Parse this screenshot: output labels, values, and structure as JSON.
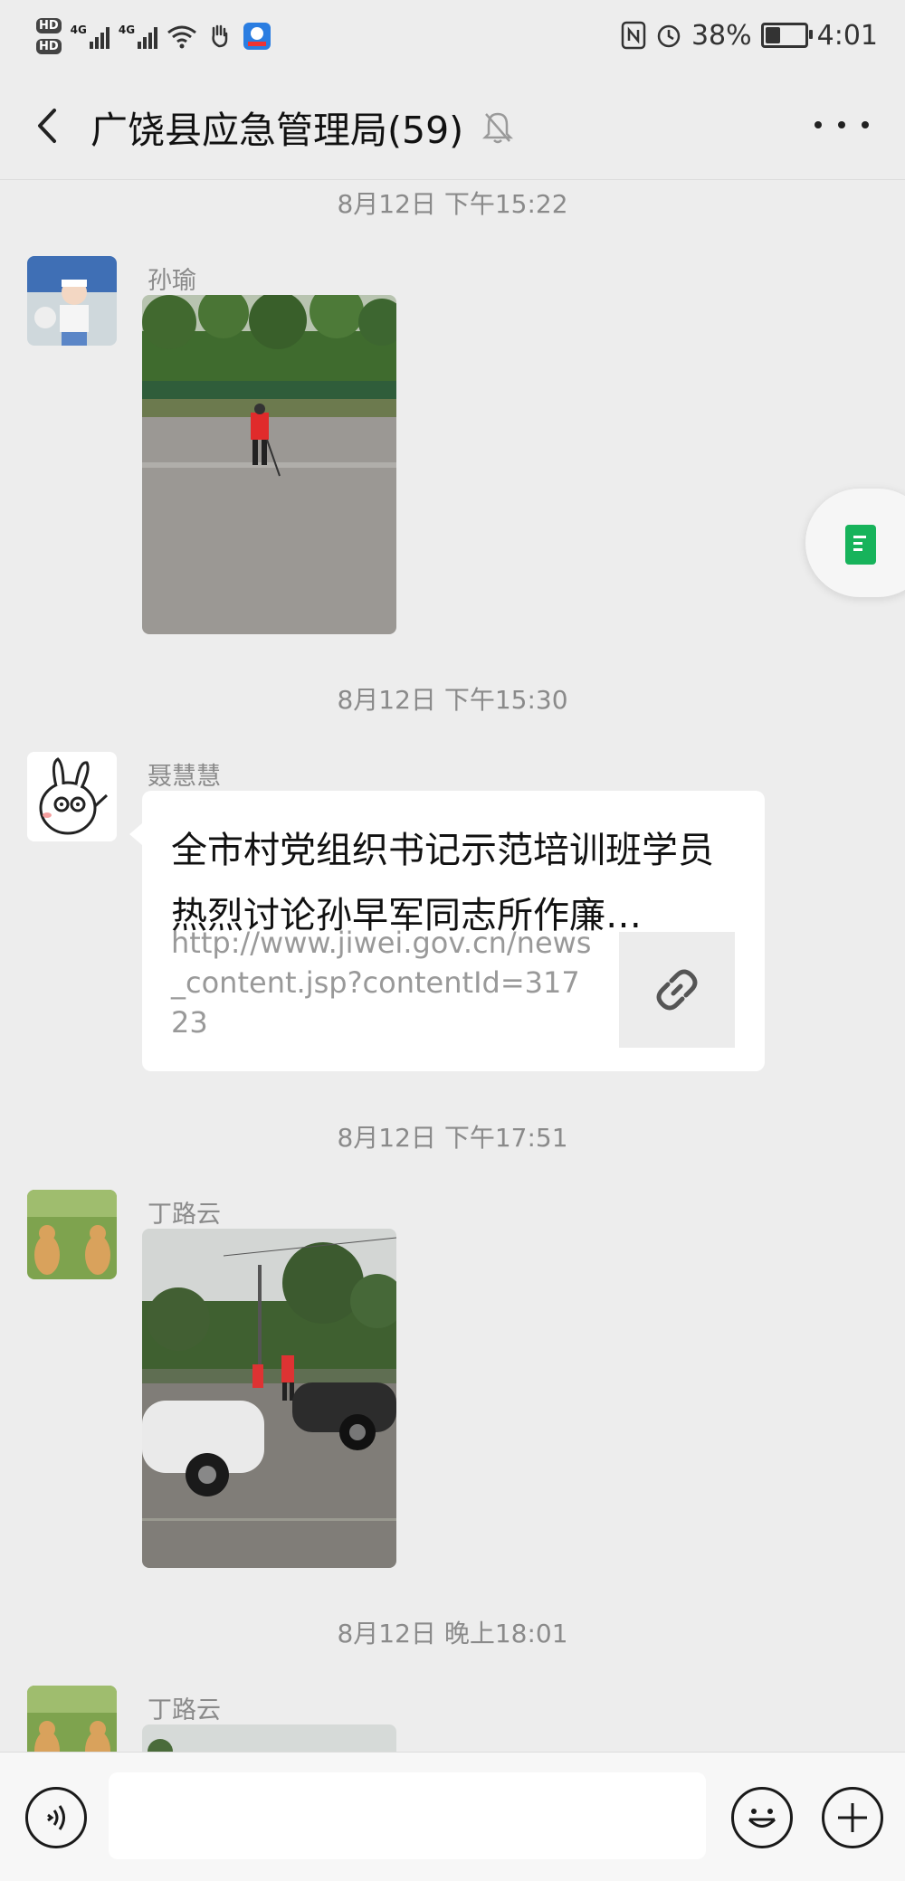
{
  "status_bar": {
    "hd1": "HD",
    "hd2": "HD",
    "net1": "4G",
    "net2": "4G",
    "battery": "38%",
    "time": "4:01"
  },
  "header": {
    "title": "广饶县应急管理局(59)",
    "icons": {
      "back": "chevron-left",
      "mute": "bell-off",
      "more": "ellipsis"
    }
  },
  "messages": [
    {
      "time": "8月12日 下午15:22",
      "sender": "孙瑜",
      "type": "image"
    },
    {
      "time": "8月12日 下午15:30",
      "sender": "聂慧慧",
      "type": "link",
      "title": "全市村党组织书记示范培训班学员热烈讨论孙早军同志所作廉…",
      "desc": "http://www.jiwei.gov.cn/news_content.jsp?contentId=31723",
      "icon": "link-icon"
    },
    {
      "time": "8月12日 下午17:51",
      "sender": "丁路云",
      "type": "image"
    },
    {
      "time": "8月12日 晚上18:01",
      "sender": "丁路云",
      "type": "image"
    }
  ],
  "input": {
    "value": ""
  },
  "colors": {
    "accent_green": "#17b35b",
    "background": "#ededed"
  }
}
